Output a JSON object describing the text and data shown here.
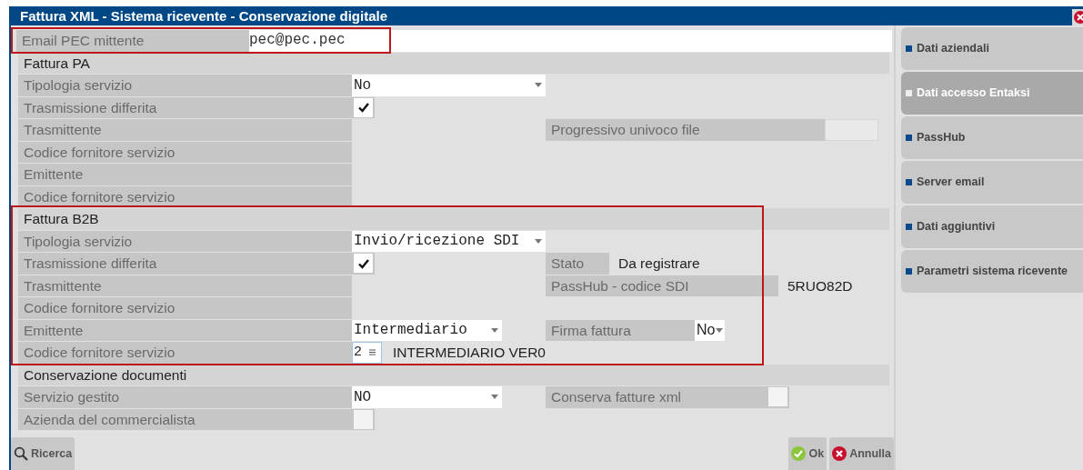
{
  "window": {
    "title": "Fattura XML - Sistema ricevente - Conservazione digitale"
  },
  "email": {
    "label": "Email PEC mittente",
    "value": "pec@pec.pec",
    "highlighted": true
  },
  "sections": [
    {
      "title": "Fattura PA",
      "highlighted": false,
      "rows": [
        {
          "label": "Tipologia servizio",
          "kind": "select",
          "value": "No"
        },
        {
          "label": "Trasmissione differita",
          "kind": "checkbox",
          "checked": true
        },
        {
          "label": "Trasmittente",
          "kind": "empty",
          "right": {
            "label": "Progressivo univoco file",
            "kind": "field"
          }
        },
        {
          "label": "Codice fornitore servizio",
          "kind": "empty"
        },
        {
          "label": "Emittente",
          "kind": "empty"
        },
        {
          "label": "Codice fornitore servizio",
          "kind": "empty"
        }
      ]
    },
    {
      "title": "Fattura B2B",
      "highlighted": true,
      "rows": [
        {
          "label": "Tipologia servizio",
          "kind": "select",
          "value": "Invio/ricezione SDI"
        },
        {
          "label": "Trasmissione differita",
          "kind": "checkbox",
          "checked": true,
          "right": {
            "label": "Stato",
            "kind": "text",
            "value": "Da registrare"
          }
        },
        {
          "label": "Trasmittente",
          "kind": "empty",
          "right": {
            "label": "PassHub - codice SDI",
            "kind": "text",
            "value": "5RUO82D"
          }
        },
        {
          "label": "Codice fornitore servizio",
          "kind": "empty"
        },
        {
          "label": "Emittente",
          "kind": "select",
          "value": "Intermediario",
          "right": {
            "label": "Firma fattura",
            "kind": "select",
            "value": "No"
          }
        },
        {
          "label": "Codice fornitore servizio",
          "kind": "lookup",
          "value": "2",
          "description": "INTERMEDIARIO VER0"
        }
      ]
    },
    {
      "title": "Conservazione documenti",
      "highlighted": false,
      "rows": [
        {
          "label": "Servizio gestito",
          "kind": "select",
          "value": "NO",
          "right": {
            "label": "Conserva fatture xml",
            "kind": "checkbox",
            "checked": false
          }
        },
        {
          "label": "Azienda del commercialista",
          "kind": "checkbox",
          "checked": false
        }
      ]
    }
  ],
  "side_buttons": [
    {
      "label": "Dati aziendali",
      "disabled": false
    },
    {
      "label": "Dati accesso Entaksi",
      "disabled": true
    },
    {
      "label": "PassHub",
      "disabled": false
    },
    {
      "label": "Server email",
      "disabled": false
    },
    {
      "label": "Dati aggiuntivi",
      "disabled": false
    },
    {
      "label": "Parametri sistema ricevente",
      "disabled": false
    }
  ],
  "footer": {
    "search": "Ricerca",
    "ok": "Ok",
    "cancel": "Annulla"
  }
}
